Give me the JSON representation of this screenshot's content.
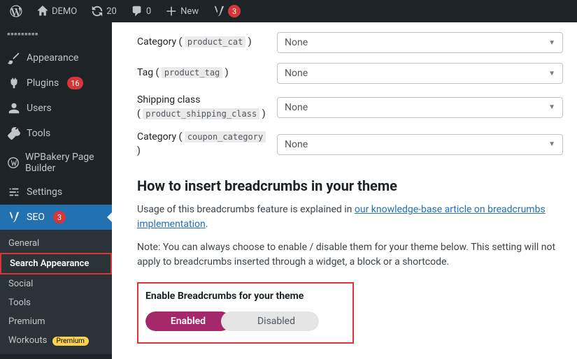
{
  "adminbar": {
    "site_name": "DEMO",
    "updates_count": "20",
    "comments_count": "0",
    "new_label": "New",
    "yoast_count": "3"
  },
  "sidebar": {
    "truncated_top": "...",
    "items": [
      {
        "label": "Appearance"
      },
      {
        "label": "Plugins",
        "count": "16"
      },
      {
        "label": "Users"
      },
      {
        "label": "Tools"
      },
      {
        "label": "WPBakery Page Builder"
      },
      {
        "label": "Settings"
      },
      {
        "label": "SEO",
        "count": "3",
        "current": true
      }
    ],
    "submenu": {
      "items": [
        {
          "label": "General"
        },
        {
          "label": "Search Appearance",
          "active": true
        },
        {
          "label": "Social"
        },
        {
          "label": "Tools"
        },
        {
          "label": "Premium"
        },
        {
          "label": "Workouts",
          "pill": "Premium"
        }
      ]
    }
  },
  "fields": [
    {
      "label": "Category",
      "slug": "product_cat",
      "value": "None"
    },
    {
      "label": "Tag",
      "slug": "product_tag",
      "value": "None"
    },
    {
      "label": "Shipping class",
      "slug": "product_shipping_class",
      "value": "None"
    },
    {
      "label": "Category",
      "slug": "coupon_category",
      "value": "None"
    }
  ],
  "section": {
    "heading": "How to insert breadcrumbs in your theme",
    "usage_prefix": "Usage of this breadcrumbs feature is explained in ",
    "link_text": "our knowledge-base article on breadcrumbs implementation",
    "usage_suffix": ".",
    "note": "Note: You can always choose to enable / disable them for your theme below. This setting will not apply to breadcrumbs inserted through a widget, a block or a shortcode."
  },
  "toggle": {
    "label": "Enable Breadcrumbs for your theme",
    "on": "Enabled",
    "off": "Disabled"
  }
}
